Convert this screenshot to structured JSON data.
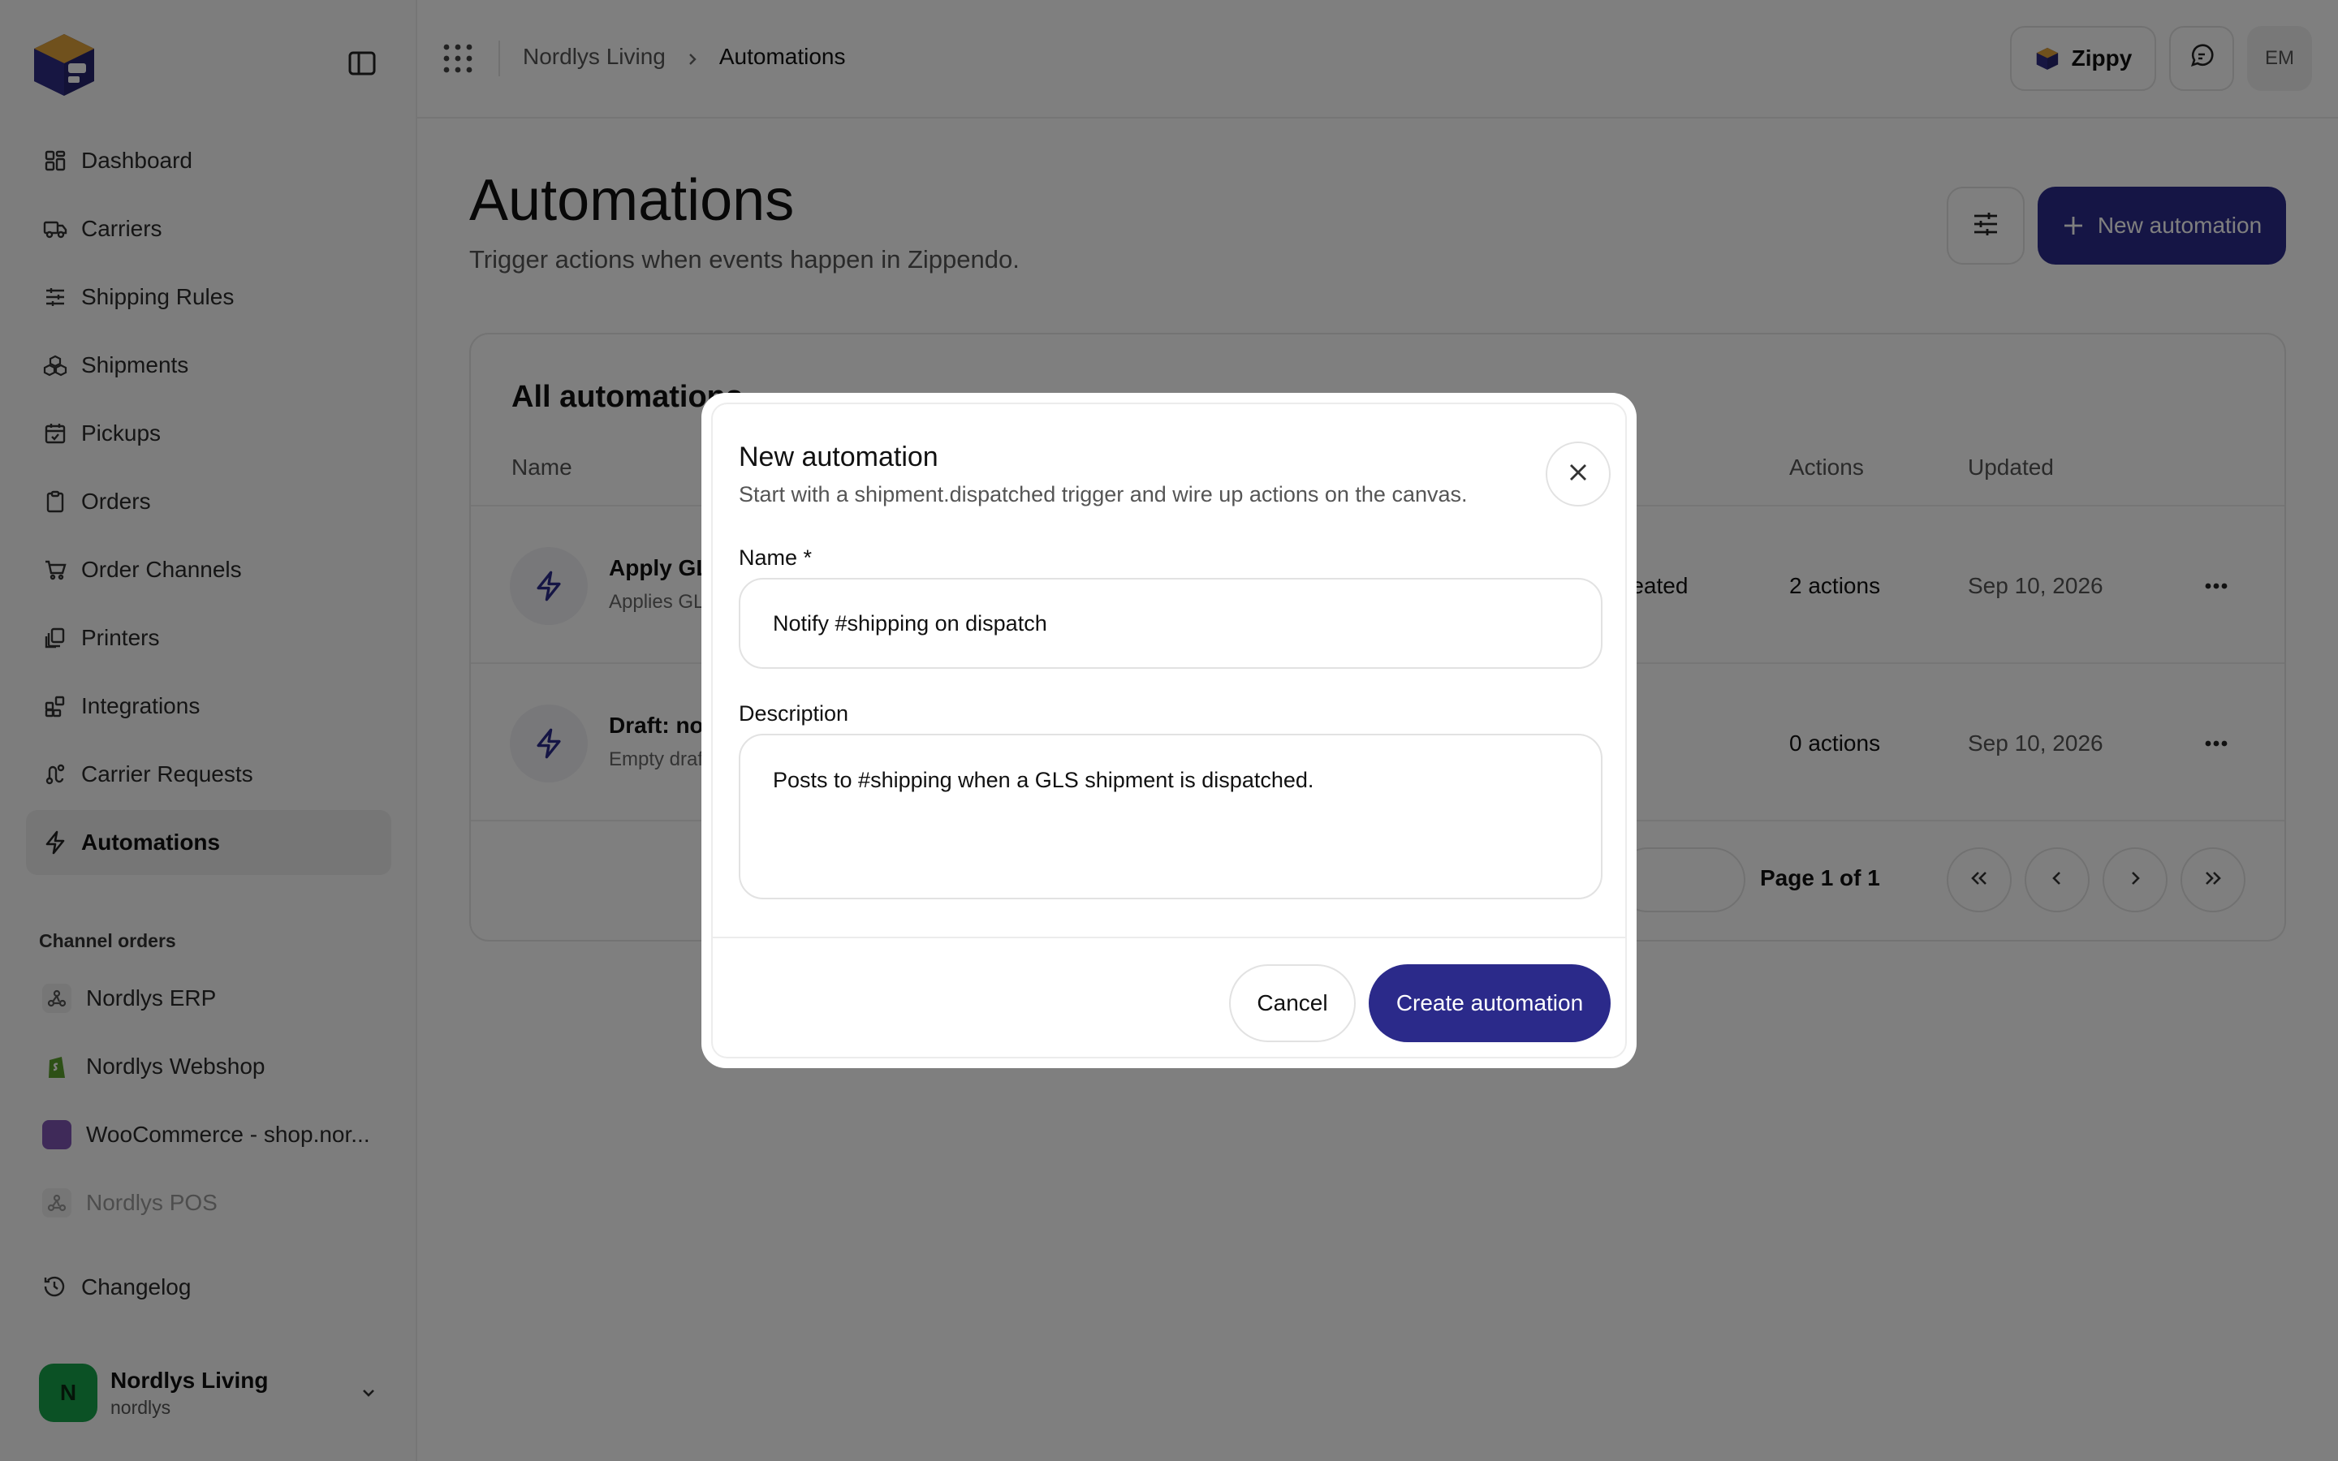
{
  "app": {
    "brand": "Zippendo",
    "accent_color": "#2b2a8a"
  },
  "sidebar": {
    "nav": [
      {
        "label": "Dashboard",
        "icon": "dashboard-icon"
      },
      {
        "label": "Carriers",
        "icon": "truck-icon"
      },
      {
        "label": "Shipping Rules",
        "icon": "sliders-icon"
      },
      {
        "label": "Shipments",
        "icon": "boxes-icon"
      },
      {
        "label": "Pickups",
        "icon": "calendar-check-icon"
      },
      {
        "label": "Orders",
        "icon": "clipboard-icon"
      },
      {
        "label": "Order Channels",
        "icon": "cart-icon"
      },
      {
        "label": "Printers",
        "icon": "printer-icon"
      },
      {
        "label": "Integrations",
        "icon": "blocks-icon"
      },
      {
        "label": "Carrier Requests",
        "icon": "route-icon"
      },
      {
        "label": "Automations",
        "icon": "bolt-icon",
        "active": true
      }
    ],
    "channels_label": "Channel orders",
    "channels": [
      {
        "label": "Nordlys ERP",
        "icon": "webhook-icon"
      },
      {
        "label": "Nordlys Webshop",
        "icon": "shopify-icon"
      },
      {
        "label": "WooCommerce - shop.nor...",
        "icon": "woocommerce-icon"
      },
      {
        "label": "Nordlys POS",
        "icon": "webhook-icon",
        "muted": true
      }
    ],
    "changelog": "Changelog",
    "account": {
      "initial": "N",
      "name": "Nordlys Living",
      "handle": "nordlys"
    }
  },
  "header": {
    "breadcrumb": [
      "Nordlys Living",
      "Automations"
    ],
    "assistant_label": "Zippy",
    "user_initials": "EM"
  },
  "main": {
    "title": "Automations",
    "subtitle": "Trigger actions when events happen in Zippendo.",
    "new_button": "New automation",
    "card_title": "All automations",
    "columns": {
      "name": "Name",
      "actions": "Actions",
      "updated": "Updated"
    },
    "rows": [
      {
        "name": "Apply GL",
        "desc": "Applies GL",
        "trigger": "reated",
        "actions": "2 actions",
        "updated": "Sep 10, 2026"
      },
      {
        "name": "Draft: not",
        "desc": "Empty draf",
        "trigger": "",
        "actions": "0 actions",
        "updated": "Sep 10, 2026"
      }
    ],
    "pager": "Page 1 of 1"
  },
  "modal": {
    "title": "New automation",
    "subtitle": "Start with a shipment.dispatched trigger and wire up actions on the canvas.",
    "name_label": "Name *",
    "name_value": "Notify #shipping on dispatch",
    "description_label": "Description",
    "description_value": "Posts to #shipping when a GLS shipment is dispatched.",
    "cancel": "Cancel",
    "create": "Create automation"
  }
}
